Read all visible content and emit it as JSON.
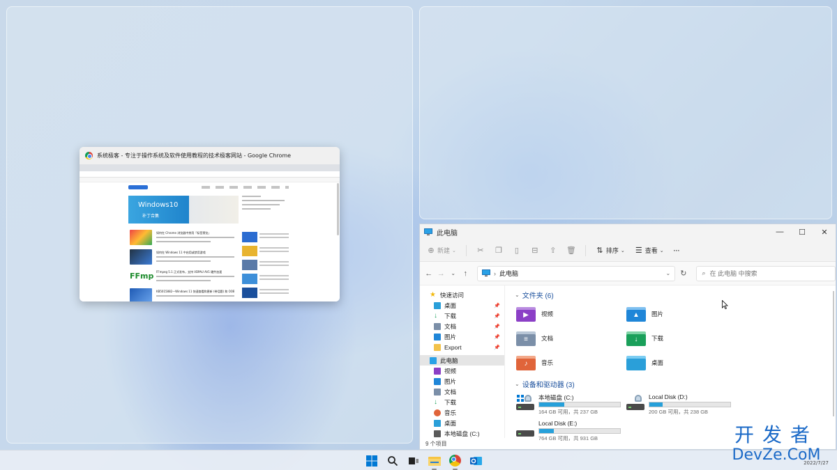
{
  "chrome_thumbnail": {
    "title": "系统极客 - 专注于操作系统及软件使用教程的技术极客网站 - Google Chrome",
    "banner_title": "Windows10",
    "banner_subtitle": "补丁合集",
    "articles": [
      "如何在 Chrome 浏览器中禁用「标签预览」",
      "如何在 Windows 11 中启用或禁用游戏",
      "FFmpeg 5.1 正式发布，支持 VDPAU AV1 硬件加速",
      "KB5015882—Windows 11 快速查看和更新 (带话题) 和 OOBE 改进"
    ]
  },
  "explorer": {
    "title": "此电脑",
    "window_controls": {
      "minimize": "—",
      "maximize": "☐",
      "close": "✕"
    },
    "toolbar": {
      "new_label": "新建",
      "sort_label": "排序",
      "view_label": "查看",
      "more_label": "···"
    },
    "address": {
      "location": "此电脑",
      "search_placeholder": "在 此电脑 中搜索"
    },
    "nav": {
      "quick_access": "快速访问",
      "pinned": [
        "桌面",
        "下载",
        "文档",
        "图片",
        "Export"
      ],
      "this_pc": "此电脑",
      "pc_items": [
        "视频",
        "图片",
        "文档",
        "下载",
        "音乐",
        "桌面",
        "本地磁盘 (C:)"
      ]
    },
    "folders_header": "文件夹 (6)",
    "folders": [
      {
        "name": "视频",
        "icon": "video-folder-icon",
        "color": "#8b3fc6"
      },
      {
        "name": "图片",
        "icon": "pictures-folder-icon",
        "color": "#1f86d8"
      },
      {
        "name": "文档",
        "icon": "documents-folder-icon",
        "color": "#7b8fa8"
      },
      {
        "name": "下载",
        "icon": "downloads-folder-icon",
        "color": "#1aa05a"
      },
      {
        "name": "音乐",
        "icon": "music-folder-icon",
        "color": "#e0643a"
      },
      {
        "name": "桌面",
        "icon": "desktop-folder-icon",
        "color": "#2a9fd9"
      }
    ],
    "drives_header": "设备和驱动器 (3)",
    "drives": [
      {
        "name": "本地磁盘 (C:)",
        "free": "164 GB 可用，共 237 GB",
        "used_fraction": 0.31
      },
      {
        "name": "Local Disk (D:)",
        "free": "200 GB 可用，共 238 GB",
        "used_fraction": 0.16
      },
      {
        "name": "Local Disk (E:)",
        "free": "764 GB 可用，共 931 GB",
        "used_fraction": 0.18
      }
    ],
    "status": "9 个项目"
  },
  "taskbar": {
    "icons": [
      "start-icon",
      "search-icon",
      "task-view-icon",
      "file-explorer-icon",
      "chrome-icon",
      "outlook-icon"
    ],
    "date": "2022/7/27"
  },
  "watermark": {
    "line1": "开发者",
    "line2": "DevZe.CoM"
  },
  "colors": {
    "accent": "#0078d4",
    "drive_fill": "#26a0da",
    "group_header": "#1a4f9c"
  }
}
